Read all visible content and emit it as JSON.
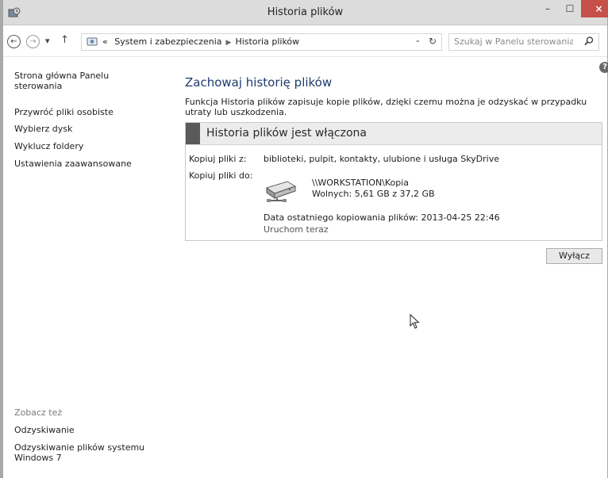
{
  "window": {
    "title": "Historia plików",
    "minimize_glyph": "–",
    "maximize_glyph": "☐",
    "close_glyph": "×"
  },
  "navigation": {
    "back_glyph": "←",
    "forward_glyph": "→",
    "recent_glyph": "▾",
    "up_glyph": "↑",
    "prefix": "«",
    "breadcrumbs": [
      "System i zabezpieczenia",
      "Historia plików"
    ],
    "dropdown_glyph": "⌄",
    "refresh_glyph": "↻"
  },
  "search": {
    "placeholder": "Szukaj w Panelu sterowania"
  },
  "sidebar": {
    "home_link": "Strona główna Panelu sterowania",
    "items": [
      "Przywróć pliki osobiste",
      "Wybierz dysk",
      "Wyklucz foldery",
      "Ustawienia zaawansowane"
    ],
    "see_also_label": "Zobacz też",
    "see_also_items": [
      "Odzyskiwanie",
      "Odzyskiwanie plików systemu Windows 7"
    ]
  },
  "main": {
    "help_glyph": "?",
    "heading": "Zachowaj historię plików",
    "description": "Funkcja Historia plików zapisuje kopie plików, dzięki czemu można je odzyskać w przypadku utraty lub uszkodzenia.",
    "status_title": "Historia plików jest włączona",
    "copy_from_label": "Kopiuj pliki z:",
    "copy_from_value": "biblioteki, pulpit, kontakty, ulubione i usługa SkyDrive",
    "copy_to_label": "Kopiuj pliki do:",
    "drive_path": "\\\\WORKSTATION\\Kopia",
    "drive_free": "Wolnych: 5,61 GB z 37,2 GB",
    "last_backup": "Data ostatniego kopiowania plików: 2013-04-25 22:46",
    "run_now": "Uruchom teraz",
    "turn_off_button": "Wyłącz"
  },
  "icons": {
    "app": "file-history-icon",
    "address": "control-panel-icon",
    "search": "search-icon",
    "drive": "network-drive-icon",
    "help": "help-icon"
  }
}
